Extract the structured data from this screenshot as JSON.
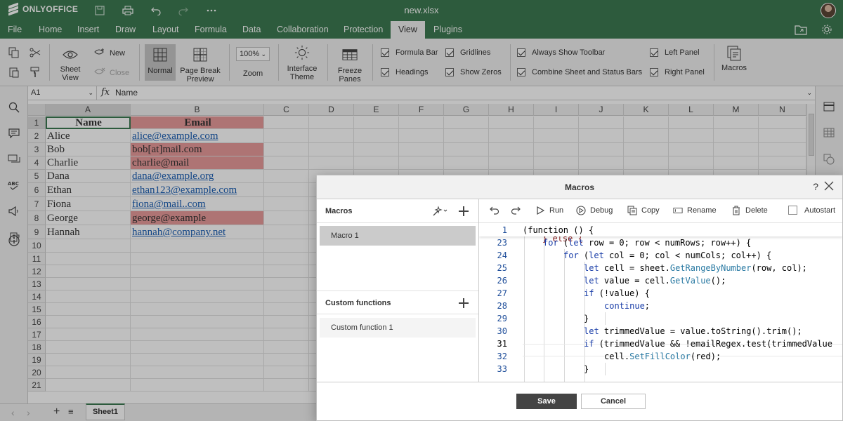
{
  "app": {
    "brand": "ONLYOFFICE",
    "doc_title": "new.xlsx"
  },
  "menu": [
    "File",
    "Home",
    "Insert",
    "Draw",
    "Layout",
    "Formula",
    "Data",
    "Collaboration",
    "Protection",
    "View",
    "Plugins"
  ],
  "active_menu": "View",
  "toolbar": {
    "sheet_view": "Sheet View",
    "new": "New",
    "close": "Close",
    "normal": "Normal",
    "page_break_preview": "Page Break Preview",
    "zoom_value": "100%",
    "zoom": "Zoom",
    "interface_theme": "Interface Theme",
    "freeze_panes": "Freeze Panes",
    "formula_bar": "Formula Bar",
    "headings": "Headings",
    "gridlines": "Gridlines",
    "show_zeros": "Show Zeros",
    "always_show_toolbar": "Always Show Toolbar",
    "combine_bars": "Combine Sheet and Status Bars",
    "left_panel": "Left Panel",
    "right_panel": "Right Panel",
    "macros": "Macros"
  },
  "formula_bar": {
    "cell_ref": "A1",
    "fx": "fx",
    "value": "Name"
  },
  "columns": [
    "A",
    "B",
    "C",
    "D",
    "E",
    "F",
    "G",
    "H",
    "I",
    "J",
    "K",
    "L",
    "M",
    "N"
  ],
  "rows": [
    "1",
    "2",
    "3",
    "4",
    "5",
    "6",
    "7",
    "8",
    "9",
    "10",
    "11",
    "12",
    "13",
    "14",
    "15",
    "16",
    "17",
    "18",
    "19",
    "20",
    "21"
  ],
  "cells": [
    {
      "a": "Name",
      "b": "Email"
    },
    {
      "a": "Alice",
      "b": "alice@example.com"
    },
    {
      "a": "Bob",
      "b": "bob[at]mail.com"
    },
    {
      "a": "Charlie",
      "b": "charlie@mail"
    },
    {
      "a": "Dana",
      "b": "dana@example.org"
    },
    {
      "a": "Ethan",
      "b": "ethan123@example.com"
    },
    {
      "a": "Fiona",
      "b": "fiona@mail..com"
    },
    {
      "a": "George",
      "b": "george@example"
    },
    {
      "a": "Hannah",
      "b": "hannah@company.net"
    }
  ],
  "sheet_tab": "Sheet1",
  "dialog": {
    "title": "Macros",
    "help": "?",
    "macros_header": "Macros",
    "macros": [
      "Macro 1"
    ],
    "custom_functions_header": "Custom functions",
    "custom_functions": [
      "Custom function 1"
    ],
    "editor_toolbar": {
      "run": "Run",
      "debug": "Debug",
      "copy": "Copy",
      "rename": "Rename",
      "delete": "Delete",
      "autostart": "Autostart"
    },
    "code": {
      "sticky_line_number": "1",
      "sticky_text": "(function () {",
      "partial_text": "} else {",
      "lines": [
        {
          "n": "23",
          "indent": 2,
          "text": "for (let row = 0; row < numRows; row++) {"
        },
        {
          "n": "24",
          "indent": 3,
          "text": "for (let col = 0; col < numCols; col++) {"
        },
        {
          "n": "25",
          "indent": 4,
          "text": "let cell = sheet.GetRangeByNumber(row, col);"
        },
        {
          "n": "26",
          "indent": 4,
          "text": "let value = cell.GetValue();"
        },
        {
          "n": "27",
          "indent": 4,
          "text": "if (!value) {"
        },
        {
          "n": "28",
          "indent": 5,
          "text": "continue;"
        },
        {
          "n": "29",
          "indent": 4,
          "text": "}"
        },
        {
          "n": "30",
          "indent": 4,
          "text": "let trimmedValue = value.toString().trim();"
        },
        {
          "n": "31",
          "indent": 4,
          "text": "if (trimmedValue && !emailRegex.test(trimmedValue"
        },
        {
          "n": "32",
          "indent": 5,
          "text": "cell.SetFillColor(red);"
        },
        {
          "n": "33",
          "indent": 4,
          "text": "}"
        }
      ]
    },
    "save": "Save",
    "cancel": "Cancel"
  },
  "colors": {
    "brand_green": "#3d7a52",
    "invalid_fill": "#e99b9b",
    "link": "#1b5fb4"
  }
}
